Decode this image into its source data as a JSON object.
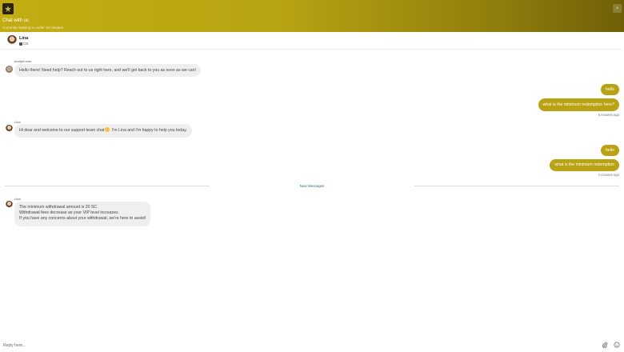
{
  "header": {
    "title": "Chat with us",
    "subtitle": "Currently replying in under 10 minutes",
    "close_icon": "×"
  },
  "agent": {
    "name": "Lina",
    "role": "CS"
  },
  "messages": {
    "bot_sender": "buckjet.com",
    "bot_text": "Hello there! Need help? Reach out to us right here, and we'll get back to you as soon as we can!",
    "user1_a": "hello",
    "user1_b": "what is the minimum redemption here?",
    "user1_time": "8 minutes ago",
    "lina1_sender": "Lina",
    "lina1_text_a": "Hi dear and welcome to our support team chat",
    "lina1_text_b": " I'm Lina and I'm happy to help you today.",
    "user2_a": "hello",
    "user2_b": "what is the minimum redemption",
    "user2_time": "2 minutes ago",
    "divider": "New Messages",
    "lina2_sender": "Lina",
    "lina2_line1": "The minimum withdrawal amount is 20 SC.",
    "lina2_line2": "Withdrawal fees decrease as your VIP level increases.",
    "lina2_line3": "If you have any concerns about your withdrawal, we're here to assist!"
  },
  "composer": {
    "placeholder": "Reply here..."
  },
  "colors": {
    "brand": "#b9a312",
    "header_dark": "#6f6008",
    "divider_text": "#2b6f7a"
  },
  "icons": [
    "brand-logo-icon",
    "close-icon",
    "agent-avatar",
    "attachment-icon",
    "emoji-icon"
  ]
}
